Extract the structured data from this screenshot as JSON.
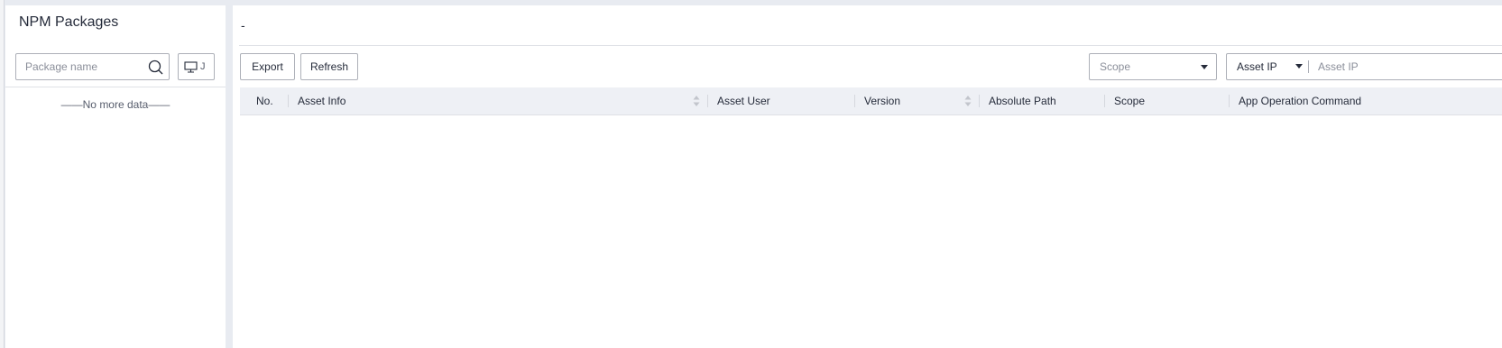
{
  "left_panel": {
    "title": "NPM Packages",
    "search_placeholder": "Package name",
    "os_button_label": "J",
    "empty_text": "——No more data——"
  },
  "right_panel": {
    "header_text": "-",
    "toolbar": {
      "export_label": "Export",
      "refresh_label": "Refresh"
    },
    "filters": {
      "scope_placeholder": "Scope",
      "asset_type_selected": "Asset IP",
      "asset_input_placeholder": "Asset IP"
    },
    "table": {
      "columns": [
        "No.",
        "Asset Info",
        "Asset User",
        "Version",
        "Absolute Path",
        "Scope",
        "App Operation Command"
      ],
      "rows": []
    }
  },
  "icons": {
    "search": "search-icon",
    "monitor": "monitor-icon",
    "sort": "sort-icon",
    "dropdown": "chevron-down-icon"
  },
  "colors": {
    "background": "#e8ebf1",
    "panel": "#ffffff",
    "table_header": "#eef0f5",
    "border": "#adb0b8",
    "text": "#252b3a",
    "placeholder": "#8a8e99"
  }
}
